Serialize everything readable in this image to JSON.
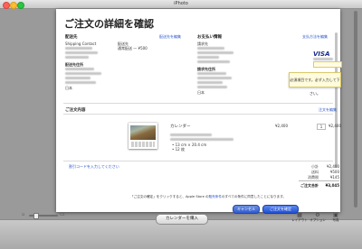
{
  "window": {
    "title": "iPhoto",
    "traffic_colors": [
      "#ff5f57",
      "#febc2e",
      "#28c840"
    ]
  },
  "sheet": {
    "heading": "ご注文の詳細を確認",
    "shipping": {
      "title": "配送先",
      "edit_link": "配送先を編集",
      "contact_label": "Shipping Contact",
      "ship_to_label": "配送先",
      "ship_method_label": "通常配送 — ¥500",
      "address_title": "配送先住所",
      "country": "日本"
    },
    "payment": {
      "title": "お支払い情報",
      "edit_link": "支払方法を編集",
      "method_label": "請求先",
      "card_brand": "VISA",
      "billing_title": "請求先住所",
      "country": "日本",
      "tooltip": "必須項目です。必ず入力して下さい。"
    },
    "order": {
      "title": "ご注文内容",
      "edit_link": "注文を編集",
      "item_name": "カレンダー",
      "unit_price": "¥2,400",
      "quantity": "1",
      "line_total": "¥2,400",
      "bullets": [
        "13 cm × 20.4 cm",
        "12 枚"
      ],
      "promo_link": "割引コードを入力してください"
    },
    "totals": [
      {
        "label": "小計",
        "value": "¥2,400"
      },
      {
        "label": "送料",
        "value": "¥500"
      },
      {
        "label": "消費税",
        "value": "¥145"
      },
      {
        "label": "ご注文合計",
        "value": "¥3,045"
      }
    ],
    "terms_prefix": "「ご注文の確定」をクリックすると、Apple Store の",
    "terms_link": "販売条件",
    "terms_suffix": "のすべての条件に同意したことになります。",
    "cancel_label": "キャンセル",
    "confirm_label": "ご注文を確定",
    "accent_color": "#2a55c9"
  },
  "toolbar": {
    "buy_button": "カレンダーを購入",
    "tools": [
      {
        "icon": "layout-icon",
        "glyph": "▦",
        "label": "レイアウト"
      },
      {
        "icon": "options-icon",
        "glyph": "⚙",
        "label": "オプション"
      },
      {
        "icon": "photos-icon",
        "glyph": "▣",
        "label": "写真"
      }
    ]
  }
}
